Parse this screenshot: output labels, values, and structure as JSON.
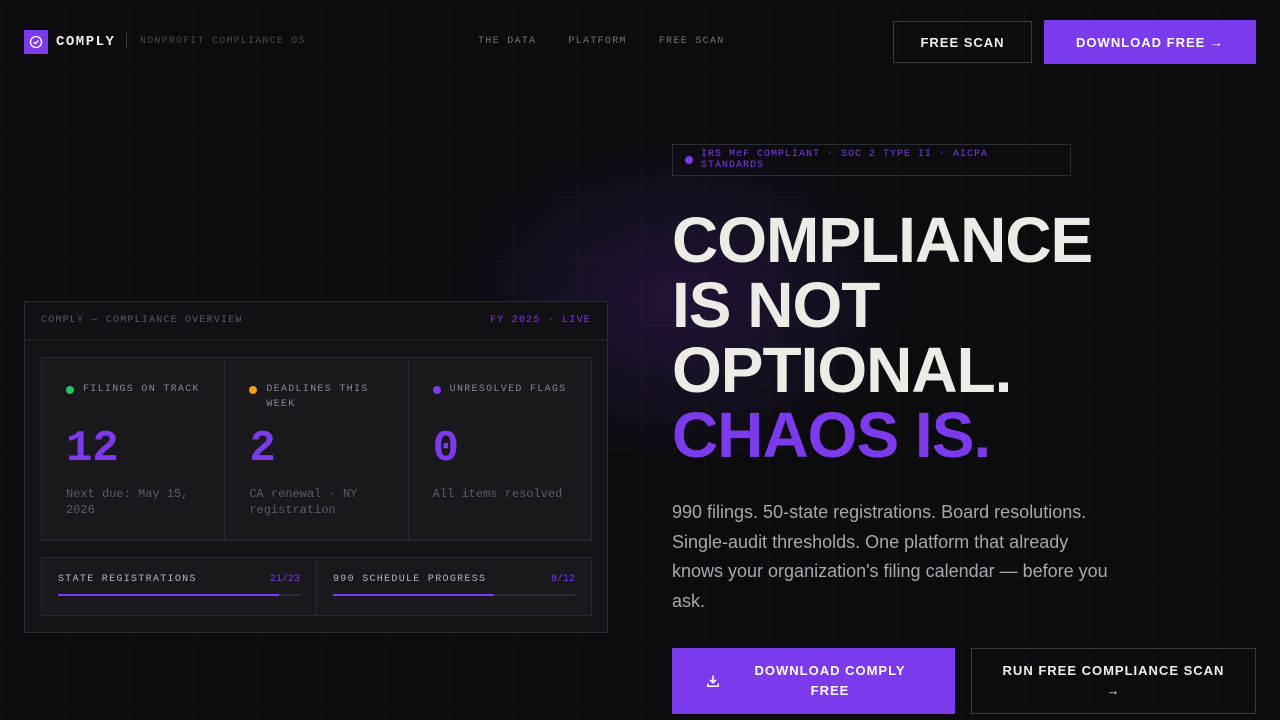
{
  "brand": {
    "name": "COMPLY",
    "tagline": "NONPROFIT COMPLIANCE OS"
  },
  "nav": {
    "links": [
      "THE DATA",
      "PLATFORM",
      "FREE SCAN"
    ],
    "free_scan_label": "FREE SCAN",
    "download_label": "DOWNLOAD FREE →"
  },
  "dashboard": {
    "title": "COMPLY — COMPLIANCE OVERVIEW",
    "status": "FY 2025 · LIVE",
    "stats": [
      {
        "label": "FILINGS ON TRACK",
        "value": "12",
        "sub": "Next due: May 15, 2026",
        "dot_color": "#22c55e"
      },
      {
        "label": "DEADLINES THIS WEEK",
        "value": "2",
        "sub": "CA renewal · NY registration",
        "dot_color": "#f59e0b"
      },
      {
        "label": "UNRESOLVED FLAGS",
        "value": "0",
        "sub": "All items resolved",
        "dot_color": "#7c3aed"
      }
    ],
    "progress": [
      {
        "label": "STATE REGISTRATIONS",
        "count": "21/23",
        "fraction": 0.913
      },
      {
        "label": "990 SCHEDULE PROGRESS",
        "count": "8/12",
        "fraction": 0.667
      }
    ]
  },
  "hero": {
    "badge": "IRS MeF COMPLIANT · SOC 2 TYPE II · AICPA STANDARDS",
    "headline_lines": [
      "COMPLIANCE",
      "IS NOT",
      "OPTIONAL."
    ],
    "headline_accent": "CHAOS IS.",
    "lede": "990 filings. 50-state registrations. Board resolutions. Single-audit thresholds. One platform that already knows your organization's filing calendar — before you ask.",
    "cta_primary": "DOWNLOAD COMPLY FREE",
    "cta_secondary": "RUN FREE COMPLIANCE SCAN",
    "cta_secondary_arrow": "→"
  },
  "colors": {
    "accent": "#7c3aed",
    "background": "#0c0b0e"
  }
}
